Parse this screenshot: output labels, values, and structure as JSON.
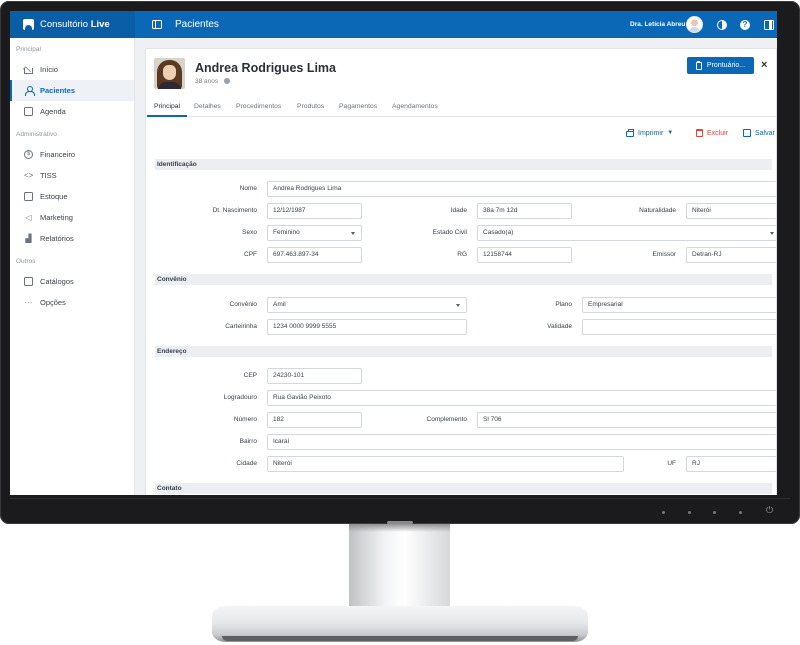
{
  "app": {
    "brand_prefix": "Consultório",
    "brand_suffix": "Live",
    "page_title": "Pacientes",
    "user_name": "Dra. Letícia Abreu"
  },
  "sidebar": {
    "sections": [
      {
        "title": "Principal",
        "items": [
          {
            "label": "Início",
            "icon": "home-icon",
            "active": false
          },
          {
            "label": "Pacientes",
            "icon": "user-icon",
            "active": true
          },
          {
            "label": "Agenda",
            "icon": "calendar-icon",
            "active": false
          }
        ]
      },
      {
        "title": "Administrativo",
        "items": [
          {
            "label": "Financeiro",
            "icon": "dollar-icon",
            "active": false
          },
          {
            "label": "TISS",
            "icon": "code-icon",
            "active": false
          },
          {
            "label": "Estoque",
            "icon": "package-icon",
            "active": false
          },
          {
            "label": "Marketing",
            "icon": "megaphone-icon",
            "active": false
          },
          {
            "label": "Relatórios",
            "icon": "chart-icon",
            "active": false
          }
        ]
      },
      {
        "title": "Outros",
        "items": [
          {
            "label": "Catálogos",
            "icon": "book-icon",
            "active": false
          },
          {
            "label": "Opções",
            "icon": "more-icon",
            "active": false
          }
        ]
      }
    ]
  },
  "patient": {
    "name": "Andrea Rodrigues Lima",
    "age": "38 anos"
  },
  "header_actions": {
    "prontuario": "Prontuário..."
  },
  "tabs": [
    "Principal",
    "Detalhes",
    "Procedimentos",
    "Produtos",
    "Pagamentos",
    "Agendamentos"
  ],
  "toolbar": {
    "print": "Imprimir",
    "delete": "Excluir",
    "save": "Salvar"
  },
  "sections": {
    "identificacao": "Identificação",
    "convenio": "Convênio",
    "endereco": "Endereço",
    "contato": "Contato"
  },
  "form": {
    "nome": {
      "label": "Nome",
      "value": "Andrea Rodrigues Lima"
    },
    "dt_nascimento": {
      "label": "Dt. Nascimento",
      "value": "12/12/1987"
    },
    "idade": {
      "label": "Idade",
      "value": "38a 7m 12d"
    },
    "naturalidade": {
      "label": "Naturalidade",
      "value": "Niterói"
    },
    "sexo": {
      "label": "Sexo",
      "value": "Feminino"
    },
    "estado_civil": {
      "label": "Estado Civil",
      "value": "Casado(a)"
    },
    "cpf": {
      "label": "CPF",
      "value": "697.463.897-34"
    },
    "rg": {
      "label": "RG",
      "value": "12158744"
    },
    "emissor": {
      "label": "Emissor",
      "value": "Detran-RJ"
    },
    "convenio": {
      "label": "Convênio",
      "value": "Amil"
    },
    "plano": {
      "label": "Plano",
      "value": "Empresarial"
    },
    "carteirinha": {
      "label": "Carteirinha",
      "value": "1234 0000 9999 5555"
    },
    "validade": {
      "label": "Validade",
      "value": ""
    },
    "cep": {
      "label": "CEP",
      "value": "24230-101"
    },
    "logradouro": {
      "label": "Logradouro",
      "value": "Rua Gavião Peixoto"
    },
    "numero": {
      "label": "Número",
      "value": "182"
    },
    "complemento": {
      "label": "Complemento",
      "value": "Sl 706"
    },
    "bairro": {
      "label": "Bairro",
      "value": "Icaraí"
    },
    "cidade": {
      "label": "Cidade",
      "value": "Niterói"
    },
    "uf": {
      "label": "UF",
      "value": "RJ"
    }
  }
}
